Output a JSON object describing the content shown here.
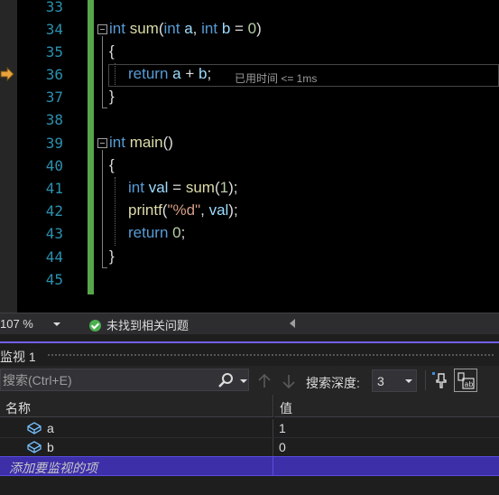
{
  "editor": {
    "lines": [
      {
        "n": "33"
      },
      {
        "n": "34"
      },
      {
        "n": "35"
      },
      {
        "n": "36"
      },
      {
        "n": "37"
      },
      {
        "n": "38"
      },
      {
        "n": "39"
      },
      {
        "n": "40"
      },
      {
        "n": "41"
      },
      {
        "n": "42"
      },
      {
        "n": "43"
      },
      {
        "n": "44"
      },
      {
        "n": "45"
      }
    ],
    "perf_tip": "已用时间 <= 1ms",
    "change_bar_color": "#57a64a",
    "breakpoint_arrow_color": "#e8a33d"
  },
  "status": {
    "zoom": "107 %",
    "issues": "未找到相关问题"
  },
  "watch": {
    "title": "监视 1",
    "search_placeholder": "搜索(Ctrl+E)",
    "depth_label": "搜索深度:",
    "depth_value": "3",
    "columns": {
      "name": "名称",
      "value": "值"
    },
    "rows": [
      {
        "name": "a",
        "value": "1"
      },
      {
        "name": "b",
        "value": "0"
      }
    ],
    "add_label": "添加要监视的项",
    "accent_color": "#7160e8"
  }
}
